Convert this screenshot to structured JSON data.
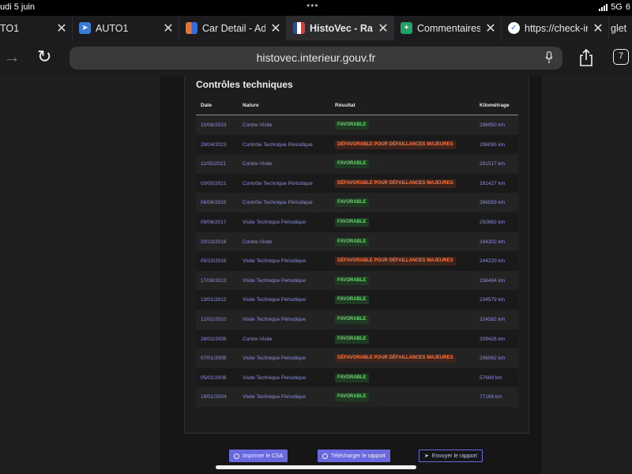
{
  "status": {
    "time": "udi 5 juin",
    "network": "5G",
    "battery": "6"
  },
  "tabs": [
    {
      "title": "TO1",
      "favicon": "none",
      "color": ""
    },
    {
      "title": "AUTO1",
      "favicon": "auto1-icon",
      "color": "#3b7bd8"
    },
    {
      "title": "Car Detail - Adv",
      "favicon": "car-detail-icon",
      "color": "#e8732a"
    },
    {
      "title": "HistoVec - Rapp",
      "favicon": "french-flag-icon",
      "color": "#e03a3a"
    },
    {
      "title": "Commentaires",
      "favicon": "sheets-icon",
      "color": "#21a366"
    },
    {
      "title": "https://check-in",
      "favicon": "check-icon",
      "color": "#3b6fe0"
    },
    {
      "title": "glet",
      "favicon": "none",
      "color": ""
    }
  ],
  "nav": {
    "url": "histovec.interieur.gouv.fr",
    "tab_count": "7"
  },
  "section_title": "Contrôles techniques",
  "columns": {
    "date": "Date",
    "nature": "Nature",
    "result": "Résultat",
    "km": "Kilométrage"
  },
  "rows": [
    {
      "date": "10/06/2023",
      "nature": "Contre-Visite",
      "result": "FAVORABLE",
      "km": "296950 km"
    },
    {
      "date": "29/04/2023",
      "nature": "Contrôle Technique Périodique",
      "result": "DÉFAVORABLE POUR DÉFAILLANCES MAJEURES",
      "km": "296095 km"
    },
    {
      "date": "11/05/2021",
      "nature": "Contre-Visite",
      "result": "FAVORABLE",
      "km": "281517 km"
    },
    {
      "date": "03/05/2021",
      "nature": "Contrôle Technique Périodique",
      "result": "DÉFAVORABLE POUR DÉFAILLANCES MAJEURES",
      "km": "281427 km"
    },
    {
      "date": "06/06/2019",
      "nature": "Contrôle Technique Périodique",
      "result": "FAVORABLE",
      "km": "266593 km"
    },
    {
      "date": "09/06/2017",
      "nature": "Visite Technique Périodique",
      "result": "FAVORABLE",
      "km": "250862 km"
    },
    {
      "date": "20/10/2016",
      "nature": "Contre-Visite",
      "result": "FAVORABLE",
      "km": "244302 km"
    },
    {
      "date": "05/10/2016",
      "nature": "Visite Technique Périodique",
      "result": "DÉFAVORABLE POUR DÉFAILLANCES MAJEURES",
      "km": "244220 km"
    },
    {
      "date": "17/08/2013",
      "nature": "Visite Technique Périodique",
      "result": "FAVORABLE",
      "km": "236484 km"
    },
    {
      "date": "13/01/2012",
      "nature": "Visite Technique Périodique",
      "result": "FAVORABLE",
      "km": "234579 km"
    },
    {
      "date": "12/01/2010",
      "nature": "Visite Technique Périodique",
      "result": "FAVORABLE",
      "km": "224582 km"
    },
    {
      "date": "28/02/2008",
      "nature": "Contre-Visite",
      "result": "FAVORABLE",
      "km": "209426 km"
    },
    {
      "date": "07/01/2008",
      "nature": "Visite Technique Périodique",
      "result": "DÉFAVORABLE POUR DÉFAILLANCES MAJEURES",
      "km": "206562 km"
    },
    {
      "date": "05/01/2006",
      "nature": "Visite Technique Périodique",
      "result": "FAVORABLE",
      "km": "57669 km"
    },
    {
      "date": "19/01/2004",
      "nature": "Visite Technique Périodique",
      "result": "FAVORABLE",
      "km": "77169 km"
    }
  ],
  "buttons": {
    "print": "Imprimer le CSA",
    "download": "Télécharger le rapport",
    "send": "Envoyer le rapport"
  },
  "colors": {
    "favorable": "#6ed36f",
    "defavorable": "#ff7a45",
    "accent": "#6a6ae0",
    "link": "#8f90e0"
  }
}
